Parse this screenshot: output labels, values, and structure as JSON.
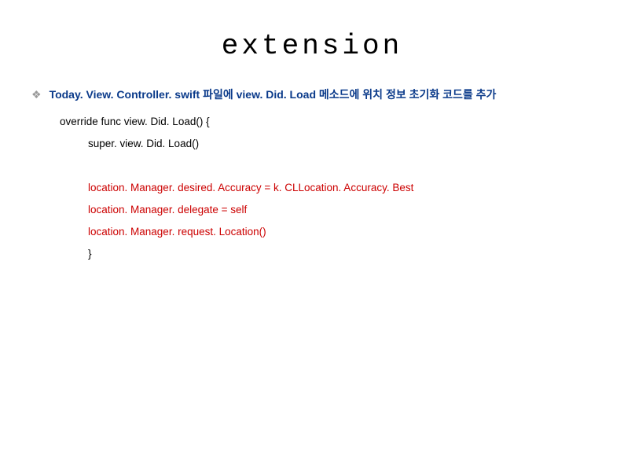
{
  "title": "extension",
  "bullet": {
    "icon": "❖",
    "heading": "Today. View. Controller. swift 파일에 view. Did. Load 메소드에 위치 정보 초기화 코드를 추가"
  },
  "code": {
    "line1": "override func view. Did. Load() {",
    "line2": "super. view. Did. Load()",
    "line3": "location. Manager. desired. Accuracy = k. CLLocation. Accuracy. Best",
    "line4": "location. Manager. delegate = self",
    "line5": "location. Manager. request. Location()",
    "line6": "}"
  }
}
